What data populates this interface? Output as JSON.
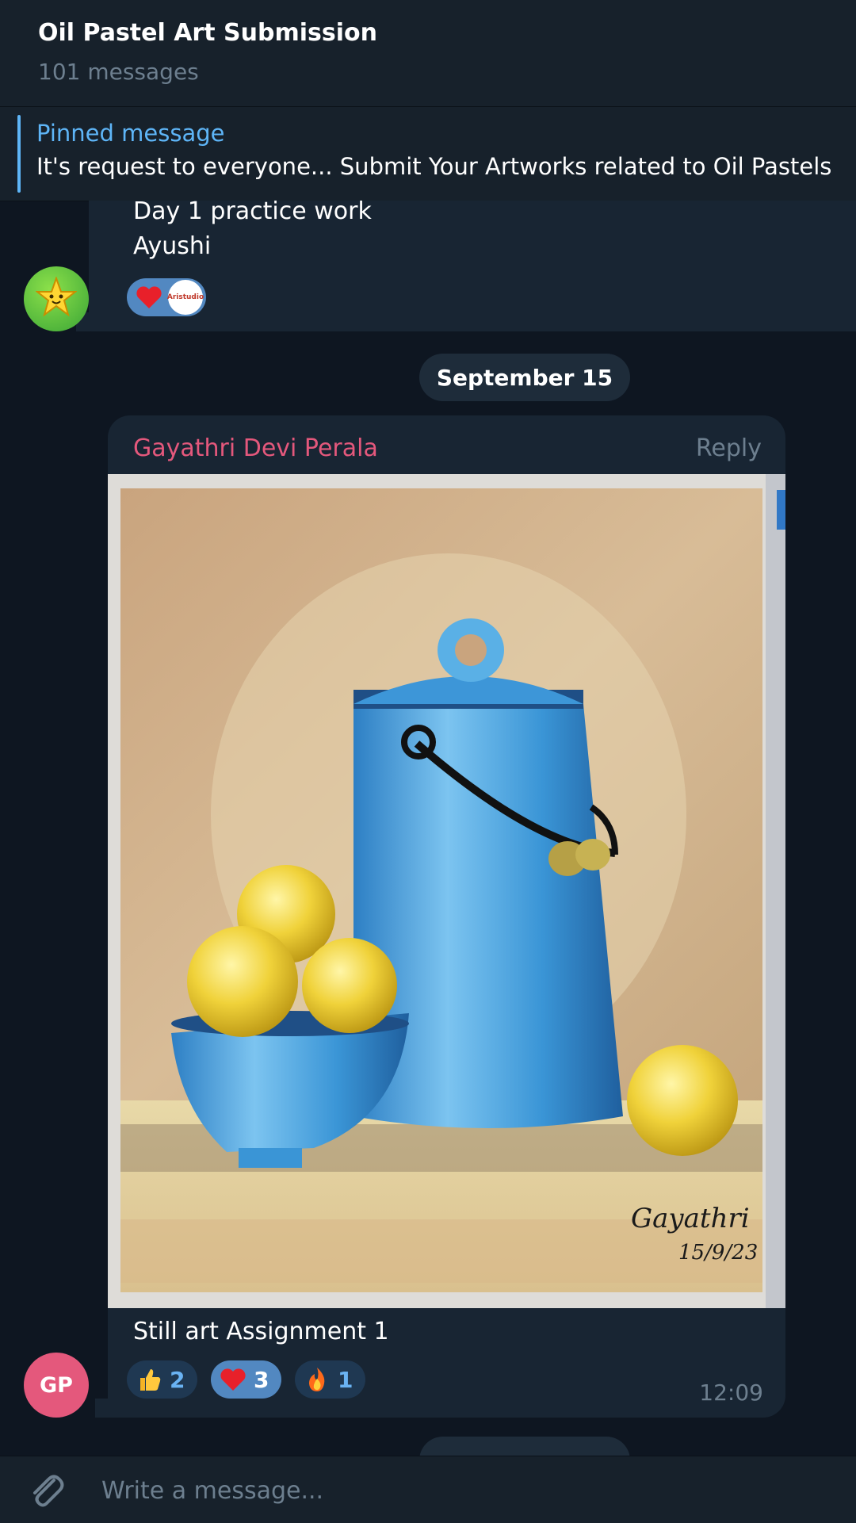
{
  "header": {
    "title": "Oil Pastel Art Submission",
    "subtitle": "101 messages"
  },
  "pinned": {
    "label": "Pinned message",
    "text": "It's request to everyone... Submit Your Artworks related to Oil Pastels"
  },
  "messages": [
    {
      "lines": [
        "Day 1 practice work",
        "Ayushi"
      ],
      "avatar_icon": "star-face-icon",
      "reactions": [
        {
          "emoji": "heart",
          "reactor": "Aristudio"
        }
      ]
    },
    {
      "author": "Gayathri Devi Perala",
      "reply_label": "Reply",
      "photo": {
        "signature": "Gayathri",
        "date_written": "15/9/23"
      },
      "caption": "Still art Assignment 1",
      "time": "12:09",
      "avatar_initials": "GP",
      "reactions": [
        {
          "emoji": "thumbs-up",
          "count": "2"
        },
        {
          "emoji": "heart",
          "count": "3"
        },
        {
          "emoji": "fire",
          "count": "1"
        }
      ]
    }
  ],
  "date_separator": "September 15",
  "composer": {
    "placeholder": "Write a message..."
  },
  "colors": {
    "background": "#0e1621",
    "header": "#17212b",
    "bubble": "#182533",
    "accent": "#5eb5f7",
    "author": "#e4587c",
    "muted": "#6d7f8f"
  }
}
